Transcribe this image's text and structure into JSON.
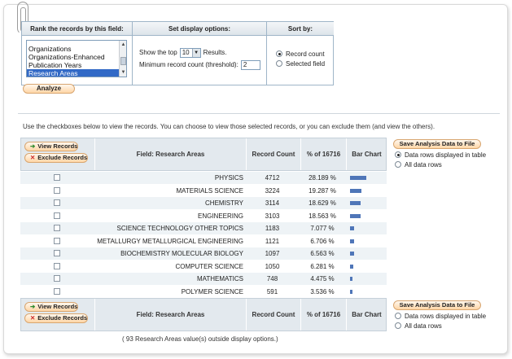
{
  "options_panel": {
    "rank_header": "Rank the records by this field:",
    "display_header": "Set display options:",
    "sort_header": "Sort by:",
    "fields": [
      "Organizations",
      "Organizations-Enhanced",
      "Publication Years",
      "Research Areas"
    ],
    "selected_field": "Research Areas",
    "show_top_label": "Show the top",
    "show_top_value": "10",
    "results_label": "Results.",
    "threshold_label": "Minimum record count (threshold):",
    "threshold_value": "2",
    "sort_record_count": "Record count",
    "sort_selected_field": "Selected field",
    "analyze_label": "Analyze"
  },
  "instructions": "Use the checkboxes below to view the records. You can choose to view those selected records, or you can exclude them (and view the others).",
  "table": {
    "view_records": "View Records",
    "exclude_records": "Exclude Records",
    "col_field": "Field: Research Areas",
    "col_count": "Record Count",
    "col_percent": "% of 16716",
    "col_bar": "Bar Chart",
    "save_label": "Save Analysis Data to File",
    "save_opt_displayed": "Data rows displayed in table",
    "save_opt_all": "All data rows",
    "rows": [
      {
        "name": "PHYSICS",
        "count": "4712",
        "percent": "28.189 %",
        "fraction": 0.28189
      },
      {
        "name": "MATERIALS SCIENCE",
        "count": "3224",
        "percent": "19.287 %",
        "fraction": 0.19287
      },
      {
        "name": "CHEMISTRY",
        "count": "3114",
        "percent": "18.629 %",
        "fraction": 0.18629
      },
      {
        "name": "ENGINEERING",
        "count": "3103",
        "percent": "18.563 %",
        "fraction": 0.18563
      },
      {
        "name": "SCIENCE TECHNOLOGY OTHER TOPICS",
        "count": "1183",
        "percent": "7.077 %",
        "fraction": 0.07077
      },
      {
        "name": "METALLURGY METALLURGICAL ENGINEERING",
        "count": "1121",
        "percent": "6.706 %",
        "fraction": 0.06706
      },
      {
        "name": "BIOCHEMISTRY MOLECULAR BIOLOGY",
        "count": "1097",
        "percent": "6.563 %",
        "fraction": 0.06563
      },
      {
        "name": "COMPUTER SCIENCE",
        "count": "1050",
        "percent": "6.281 %",
        "fraction": 0.06281
      },
      {
        "name": "MATHEMATICS",
        "count": "748",
        "percent": "4.475 %",
        "fraction": 0.04475
      },
      {
        "name": "POLYMER SCIENCE",
        "count": "591",
        "percent": "3.536 %",
        "fraction": 0.03536
      }
    ],
    "footnote": "( 93 Research Areas value(s) outside display options.)"
  }
}
